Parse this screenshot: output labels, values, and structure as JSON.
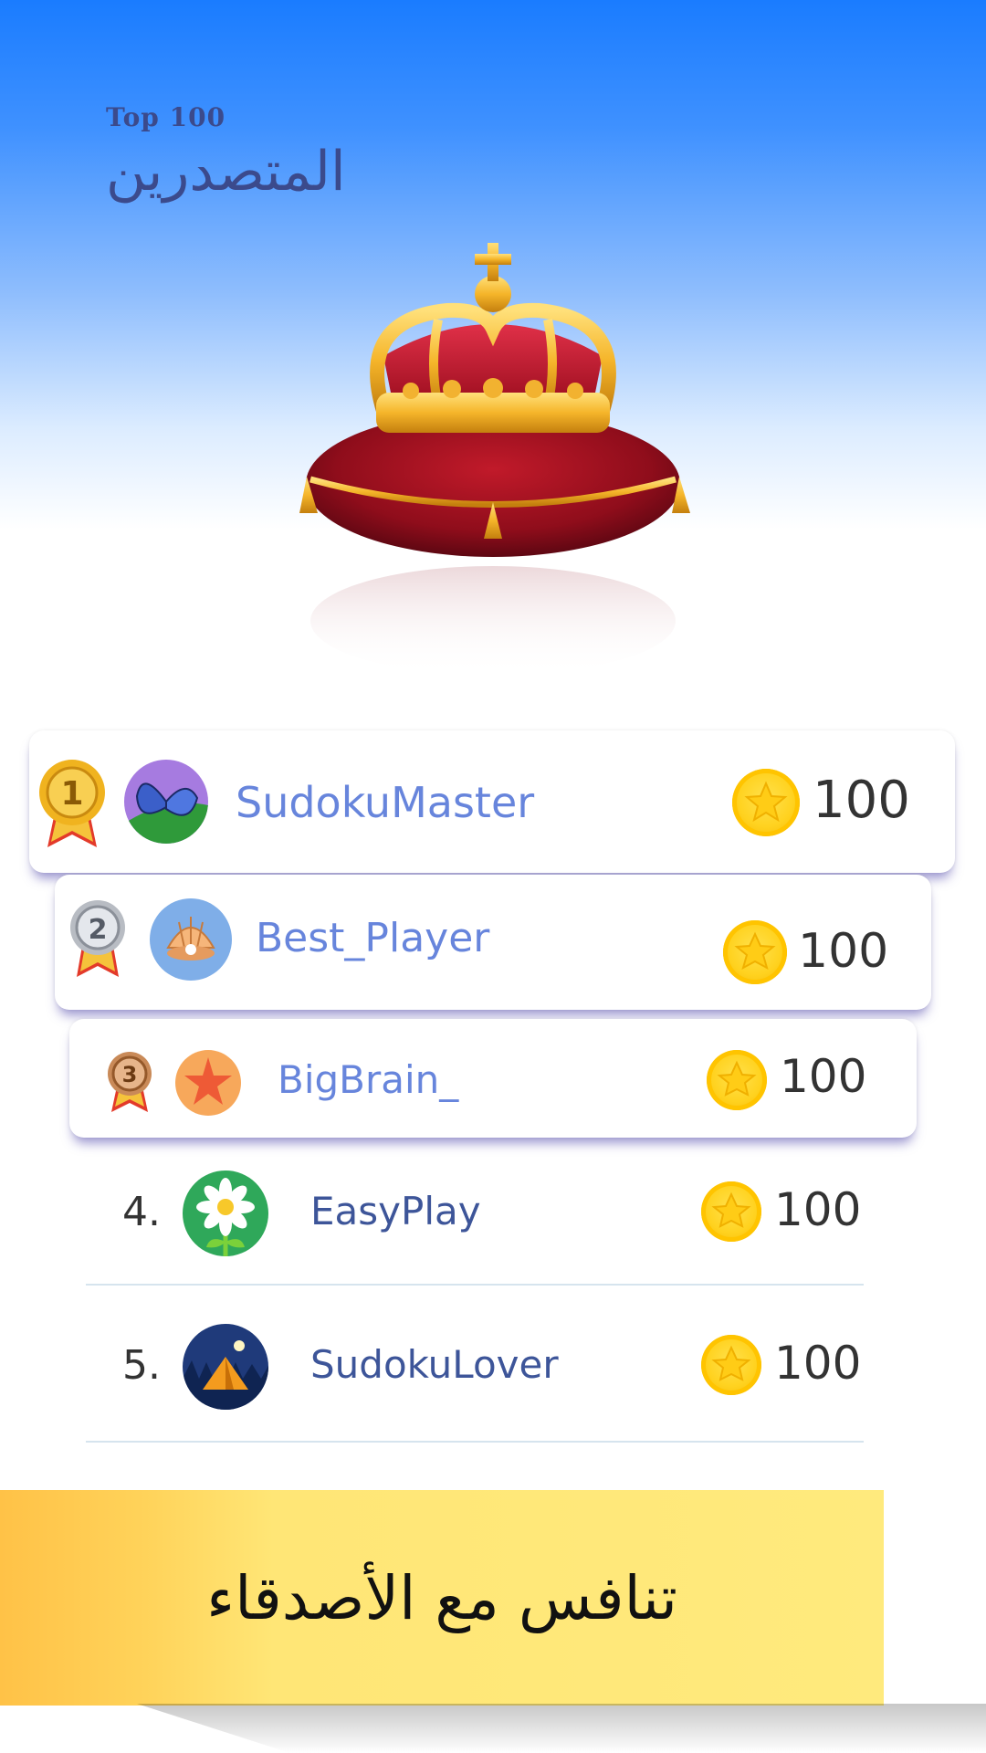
{
  "header": {
    "subtitle": "Top 100",
    "title": "المتصدرين"
  },
  "leaderboard": [
    {
      "rank": "1",
      "name": "SudokuMaster",
      "score": "100",
      "avatar": "butterfly-avatar",
      "medal": "gold-medal"
    },
    {
      "rank": "2",
      "name": "Best_Player",
      "score": "100",
      "avatar": "seashell-avatar",
      "medal": "silver-medal"
    },
    {
      "rank": "3",
      "name": "BigBrain_",
      "score": "100",
      "avatar": "starfish-avatar",
      "medal": "bronze-medal"
    },
    {
      "rank": "4.",
      "name": "EasyPlay",
      "score": "100",
      "avatar": "daisy-avatar"
    },
    {
      "rank": "5.",
      "name": "SudokuLover",
      "score": "100",
      "avatar": "tent-avatar"
    }
  ],
  "banner": {
    "text": "تنافس مع الأصدقاء"
  },
  "icons": {
    "crown": "crown-on-cushion",
    "coin": "star-coin-icon"
  },
  "colors": {
    "header_gradient_top": "#1a7cff",
    "title_color": "#3b4a8c",
    "player_name": "#6785dc",
    "coin_gold": "#ffd21f",
    "banner_yellow": "#ffea7d",
    "card_shadow": "#4a42aa"
  }
}
